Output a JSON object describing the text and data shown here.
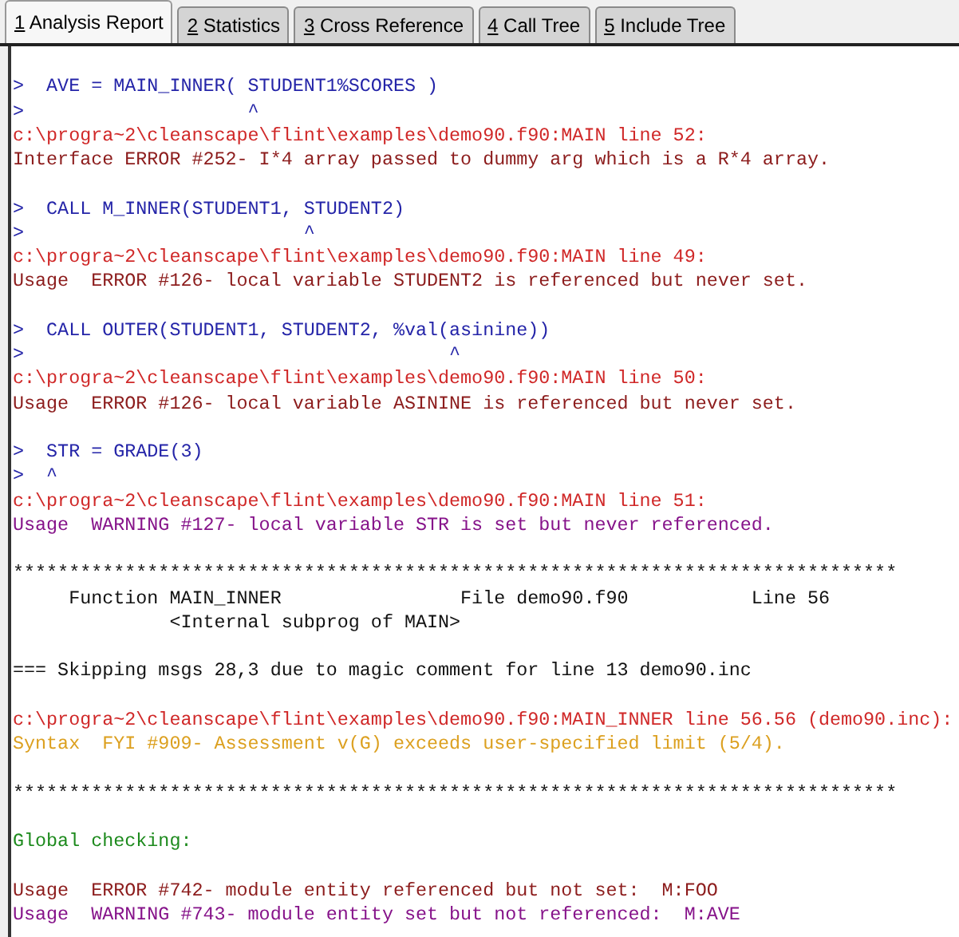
{
  "tabs": [
    {
      "key": "1",
      "label": "Analysis Report",
      "selected": true
    },
    {
      "key": "2",
      "label": "Statistics",
      "selected": false
    },
    {
      "key": "3",
      "label": "Cross Reference",
      "selected": false
    },
    {
      "key": "4",
      "label": "Call Tree",
      "selected": false
    },
    {
      "key": "5",
      "label": "Include Tree",
      "selected": false
    }
  ],
  "report_lines": [
    {
      "kind": "blank"
    },
    {
      "kind": "source",
      "text": ">  AVE = MAIN_INNER( STUDENT1%SCORES )"
    },
    {
      "kind": "source",
      "text": ">                    ^"
    },
    {
      "kind": "location",
      "text": "c:\\progra~2\\cleanscape\\flint\\examples\\demo90.f90:MAIN line 52:"
    },
    {
      "kind": "error",
      "text": "Interface ERROR #252- I*4 array passed to dummy arg which is a R*4 array."
    },
    {
      "kind": "blank"
    },
    {
      "kind": "source",
      "text": ">  CALL M_INNER(STUDENT1, STUDENT2)"
    },
    {
      "kind": "source",
      "text": ">                         ^"
    },
    {
      "kind": "location",
      "text": "c:\\progra~2\\cleanscape\\flint\\examples\\demo90.f90:MAIN line 49:"
    },
    {
      "kind": "error",
      "text": "Usage  ERROR #126- local variable STUDENT2 is referenced but never set."
    },
    {
      "kind": "blank"
    },
    {
      "kind": "source",
      "text": ">  CALL OUTER(STUDENT1, STUDENT2, %val(asinine))"
    },
    {
      "kind": "source",
      "text": ">                                      ^"
    },
    {
      "kind": "location",
      "text": "c:\\progra~2\\cleanscape\\flint\\examples\\demo90.f90:MAIN line 50:"
    },
    {
      "kind": "error",
      "text": "Usage  ERROR #126- local variable ASININE is referenced but never set."
    },
    {
      "kind": "blank"
    },
    {
      "kind": "source",
      "text": ">  STR = GRADE(3)"
    },
    {
      "kind": "source",
      "text": ">  ^"
    },
    {
      "kind": "location",
      "text": "c:\\progra~2\\cleanscape\\flint\\examples\\demo90.f90:MAIN line 51:"
    },
    {
      "kind": "warning",
      "text": "Usage  WARNING #127- local variable STR is set but never referenced."
    },
    {
      "kind": "blank"
    },
    {
      "kind": "plain",
      "text": "*******************************************************************************"
    },
    {
      "kind": "plain",
      "text": "     Function MAIN_INNER                File demo90.f90           Line 56"
    },
    {
      "kind": "plain",
      "text": "              <Internal subprog of MAIN>"
    },
    {
      "kind": "blank"
    },
    {
      "kind": "plain",
      "text": "=== Skipping msgs 28,3 due to magic comment for line 13 demo90.inc"
    },
    {
      "kind": "blank"
    },
    {
      "kind": "location",
      "text": "c:\\progra~2\\cleanscape\\flint\\examples\\demo90.f90:MAIN_INNER line 56.56 (demo90.inc):"
    },
    {
      "kind": "fyi",
      "text": "Syntax  FYI #909- Assessment v(G) exceeds user-specified limit (5/4)."
    },
    {
      "kind": "blank"
    },
    {
      "kind": "plain",
      "text": "*******************************************************************************"
    },
    {
      "kind": "blank"
    },
    {
      "kind": "heading",
      "text": "Global checking:"
    },
    {
      "kind": "blank"
    },
    {
      "kind": "error",
      "text": "Usage  ERROR #742- module entity referenced but not set:  M:FOO"
    },
    {
      "kind": "warning",
      "text": "Usage  WARNING #743- module entity set but not referenced:  M:AVE"
    }
  ]
}
